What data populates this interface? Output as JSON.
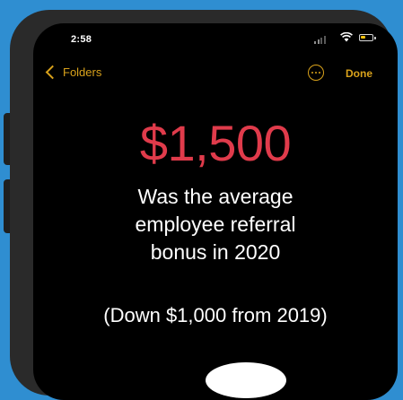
{
  "status_bar": {
    "time": "2:58",
    "battery_level": 0.45,
    "battery_color": "#f4c20d"
  },
  "nav": {
    "back_label": "Folders",
    "back_icon": "chevron-left-icon",
    "more_icon": "ellipsis-circle-icon",
    "done_label": "Done",
    "accent_color": "#d9a21b"
  },
  "note": {
    "amount": "$1,500",
    "amount_color": "#e03b4b",
    "lines": [
      "Was the average",
      "employee referral",
      "bonus in 2020"
    ],
    "footnote": "(Down $1,000 from 2019)"
  },
  "colors": {
    "background": "#2f8ed1",
    "phone_frame": "#2a2a2a",
    "screen": "#000000"
  }
}
